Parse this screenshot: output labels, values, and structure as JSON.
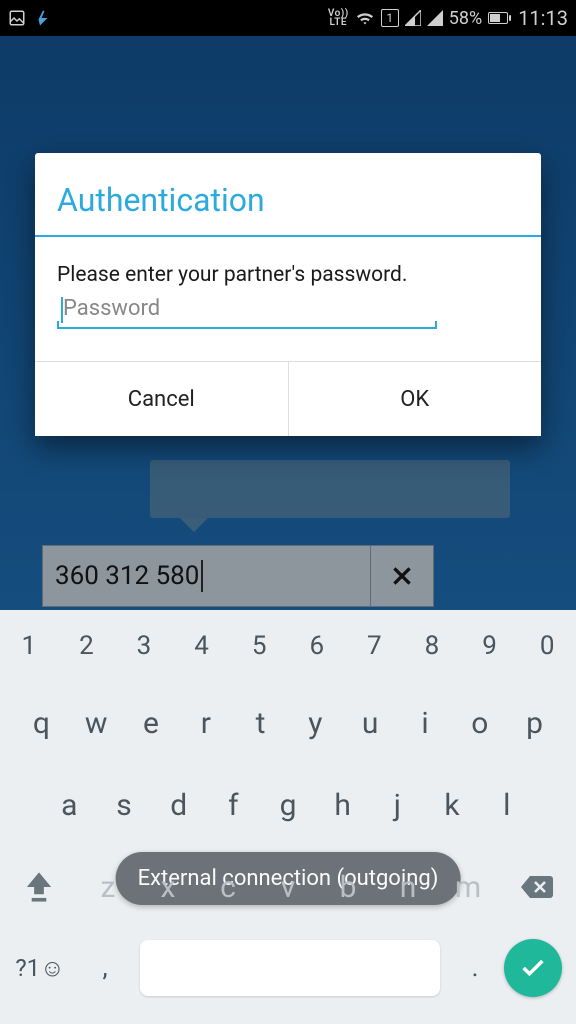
{
  "status_bar": {
    "lte_label": "Vo))\nLTE",
    "sim_slot": "1",
    "battery_pct": "58%",
    "clock": "11:13"
  },
  "partner": {
    "id_value": "360 312 580"
  },
  "dialog": {
    "title": "Authentication",
    "message": "Please enter your partner's password.",
    "password_placeholder": "Password",
    "cancel_label": "Cancel",
    "ok_label": "OK"
  },
  "toast": {
    "text": "External connection (outgoing)"
  },
  "keyboard": {
    "num_row": [
      "1",
      "2",
      "3",
      "4",
      "5",
      "6",
      "7",
      "8",
      "9",
      "0"
    ],
    "row2": [
      "q",
      "w",
      "e",
      "r",
      "t",
      "y",
      "u",
      "i",
      "o",
      "p"
    ],
    "row3": [
      "a",
      "s",
      "d",
      "f",
      "g",
      "h",
      "j",
      "k",
      "l"
    ],
    "row4_hidden": [
      "z",
      "x",
      "c",
      "v",
      "b",
      "n",
      "m"
    ],
    "sym_label": "?1☺",
    "comma": ",",
    "dot": "."
  }
}
